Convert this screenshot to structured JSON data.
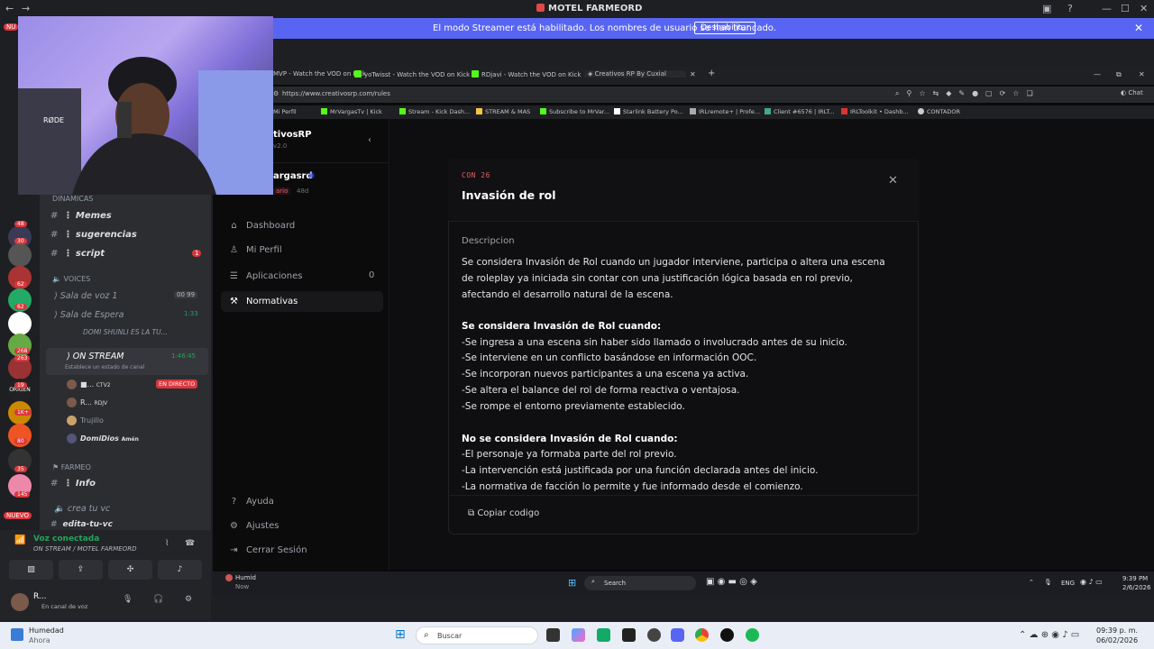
{
  "window": {
    "title": "MOTEL FARMEORD"
  },
  "streamer_banner": {
    "message": "El modo Streamer está habilitado. Los nombres de usuario se han truncado.",
    "button": "Deshabilitar"
  },
  "rail": {
    "badges": [
      "48",
      "30",
      "62",
      "62",
      "268",
      "263",
      "19",
      "1K+",
      "80",
      "35",
      "145"
    ],
    "labels": [
      "NU",
      "NUEVO"
    ]
  },
  "channels": {
    "category_dinamicas": "DINAMICAS",
    "items": [
      {
        "name": "⋮ Memes"
      },
      {
        "name": "⋮ sugerencias"
      },
      {
        "name": "⋮ script",
        "badge": "1"
      }
    ],
    "category_voices": "VOICES",
    "voice": [
      {
        "name": "⟩ Sala de voz 1",
        "meta": "00 99"
      },
      {
        "name": "⟩ Sala de Espera",
        "meta": "1:33"
      },
      {
        "name": "DOMI SHUNLI ES LA TU..."
      },
      {
        "name": "⟩ ON STREAM",
        "meta": "1:46:45",
        "status": "Establece un estado de canal"
      }
    ],
    "stream_users": [
      {
        "name": "■...",
        "tag": "CTV2",
        "live": "EN DIRECTO"
      },
      {
        "name": "R...",
        "tag": "RDJV"
      },
      {
        "name": "Trujillo"
      },
      {
        "name": "DomiDios",
        "tag": "Amén"
      }
    ],
    "category_farmeo": "FARMEO",
    "farmeo_items": [
      {
        "name": "⋮ Info"
      }
    ],
    "extra": [
      "crea tu vc",
      "edita-tu-vc"
    ]
  },
  "voice_panel": {
    "status": "Voz conectada",
    "location": "ON STREAM / MOTEL FARMEORD",
    "user_name": "R...",
    "user_status": "En canal de voz"
  },
  "browser": {
    "tabs": [
      "MVP - Watch the VOD on Kick",
      "yoTwisst - Watch the VOD on Kick",
      "RDjavi - Watch the VOD on Kick",
      "Creativos RP By Cuxial"
    ],
    "url": "https://www.creativosrp.com/rules",
    "bookmarks": [
      "Mi Perfil",
      "MrVargasTv | Kick",
      "Stream - Kick Dash...",
      "STREAM & MAS",
      "Subscribe to MrVar...",
      "Starlink Battery Po...",
      "IRLremote+ | Profe...",
      "Client #6576 | IRLT...",
      "IRLToolkit • Dashb...",
      "CONTADOR"
    ],
    "chat_label": "Chat"
  },
  "site": {
    "brand": "tivosRP",
    "version": "v2.0",
    "user": "argasrd",
    "role": "ario",
    "days": "48d",
    "nav": [
      {
        "label": "Dashboard",
        "icon": "home-icon"
      },
      {
        "label": "Mi Perfil",
        "icon": "user-icon"
      },
      {
        "label": "Aplicaciones",
        "icon": "list-icon",
        "count": "0"
      },
      {
        "label": "Normativas",
        "icon": "gavel-icon",
        "active": true
      }
    ],
    "bottom_nav": [
      {
        "label": "Ayuda",
        "icon": "help-icon"
      },
      {
        "label": "Ajustes",
        "icon": "gear-icon"
      },
      {
        "label": "Cerrar Sesión",
        "icon": "logout-icon"
      }
    ]
  },
  "modal": {
    "code": "CON 26",
    "title": "Invasión de rol",
    "description_label": "Descripcion",
    "intro": "Se considera Invasión de Rol cuando un jugador interviene, participa o altera una escena de roleplay ya iniciada sin contar con una justificación lógica basada en rol previo, afectando el desarrollo natural de la escena.",
    "yes_heading": "Se considera Invasión de Rol cuando:",
    "yes_items": [
      "-Se ingresa a una escena sin haber sido llamado o involucrado antes de su inicio.",
      "-Se interviene en un conflicto basándose en información OOC.",
      "-Se incorporan nuevos participantes a una escena ya activa.",
      "-Se altera el balance del rol de forma reactiva o ventajosa.",
      "-Se rompe el entorno previamente establecido."
    ],
    "no_heading": "No se considera Invasión de Rol cuando:",
    "no_items": [
      "-El personaje ya formaba parte del rol previo.",
      "-La intervención está justificada por una función declarada antes del inicio.",
      "-La normativa de facción lo permite y fue informado desde el comienzo."
    ],
    "copy_button": "Copiar codigo"
  },
  "inner_taskbar": {
    "weather": "Humid",
    "weather_sub": "Now",
    "search": "Search",
    "lang": "ENG",
    "time": "9:39 PM",
    "date": "2/6/2026"
  },
  "outer_taskbar": {
    "weather": "Humedad",
    "weather_sub": "Ahora",
    "search": "Buscar",
    "time": "09:39 p. m.",
    "date": "06/02/2026"
  }
}
